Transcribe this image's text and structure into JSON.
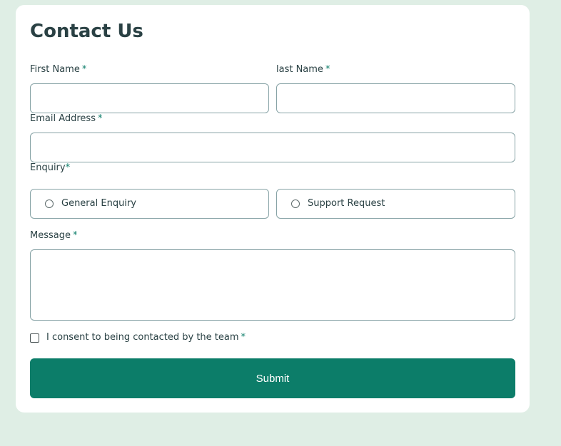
{
  "form": {
    "title": "Contact Us",
    "required_marker": "*",
    "first_name": {
      "label": "First Name",
      "value": ""
    },
    "last_name": {
      "label": "last Name",
      "value": ""
    },
    "email": {
      "label": "Email Address",
      "value": ""
    },
    "enquiry": {
      "label": "Enquiry",
      "options": [
        "General Enquiry",
        "Support Request"
      ],
      "selected": null
    },
    "message": {
      "label": "Message",
      "value": ""
    },
    "consent": {
      "label": "I consent to being contacted by the team",
      "checked": false
    },
    "submit_label": "Submit"
  },
  "colors": {
    "page_background": "#dfeee5",
    "card_background": "#ffffff",
    "heading_text": "#2a4144",
    "accent": "#0c7d69",
    "field_border": "#87a3a6"
  }
}
